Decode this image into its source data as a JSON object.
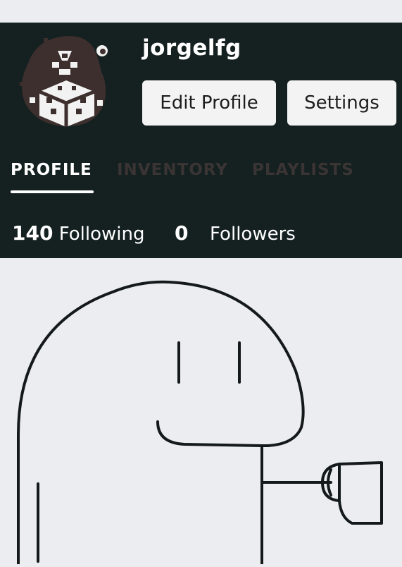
{
  "profile": {
    "username": "jorgelfg",
    "edit_button": "Edit Profile",
    "settings_button": "Settings"
  },
  "tabs": [
    {
      "label": "PROFILE",
      "active": true
    },
    {
      "label": "INVENTORY",
      "active": false
    },
    {
      "label": "PLAYLISTS",
      "active": false
    }
  ],
  "stats": {
    "following_count": "140",
    "following_label": "Following",
    "followers_count": "0",
    "followers_label": "Followers"
  },
  "colors": {
    "header_bg": "#142120",
    "page_bg": "#ecedf1",
    "active_tab": "#ffffff",
    "inactive_tab": "#3b3434"
  },
  "icons": {
    "avatar": "pixel-art-creature-avatar",
    "illustration": "cartoon-character-holding-cup"
  }
}
